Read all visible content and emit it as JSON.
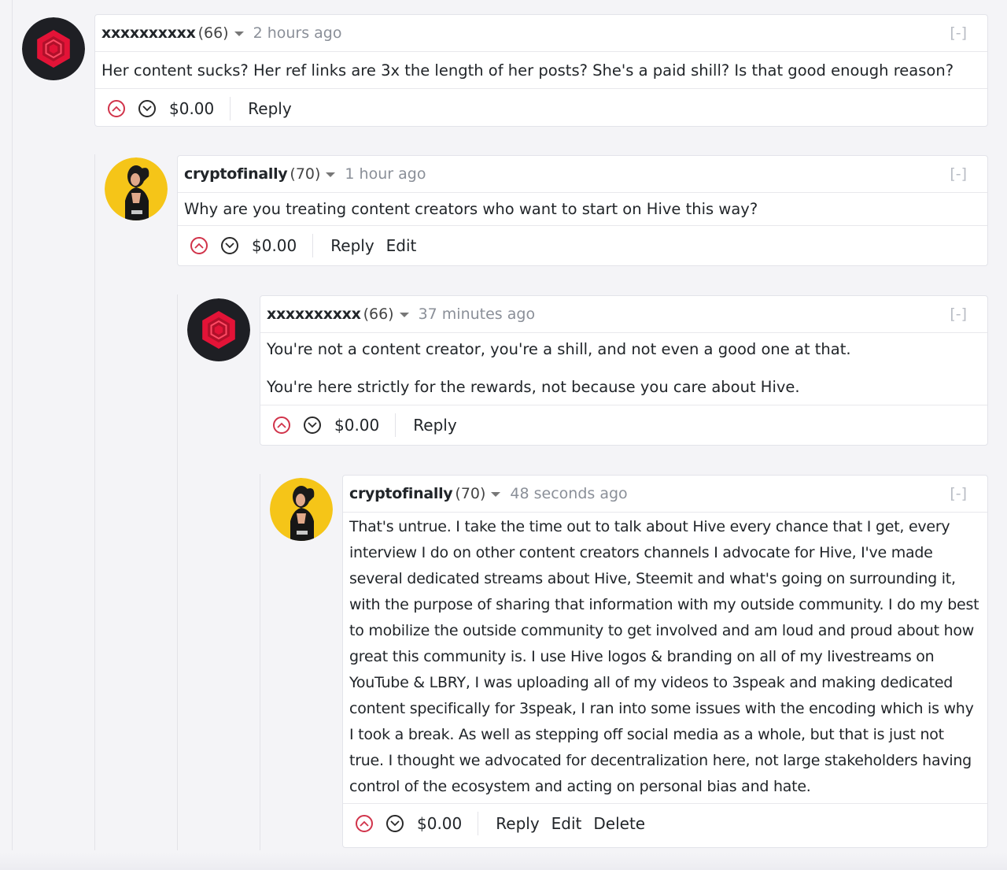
{
  "comments": [
    {
      "author": "xxxxxxxxxx",
      "reputation": "(66)",
      "time": "2 hours ago",
      "collapse": "[-]",
      "paragraphs": [
        "Her content sucks? Her ref links are 3x the length of her posts? She's a paid shill? Is that good enough reason?"
      ],
      "payout": "$0.00",
      "actions": [
        "Reply"
      ],
      "avatar_icon": "hive-hexagon-icon"
    },
    {
      "author": "cryptofinally",
      "reputation": "(70)",
      "time": "1 hour ago",
      "collapse": "[-]",
      "paragraphs": [
        "Why are you treating content creators who want to start on Hive this way?"
      ],
      "payout": "$0.00",
      "actions": [
        "Reply",
        "Edit"
      ],
      "avatar_icon": "user-photo"
    },
    {
      "author": "xxxxxxxxxx",
      "reputation": "(66)",
      "time": "37 minutes ago",
      "collapse": "[-]",
      "paragraphs": [
        "You're not a content creator, you're a shill, and not even a good one at that.",
        "You're here strictly for the rewards, not because you care about Hive."
      ],
      "payout": "$0.00",
      "actions": [
        "Reply"
      ],
      "avatar_icon": "hive-hexagon-icon"
    },
    {
      "author": "cryptofinally",
      "reputation": "(70)",
      "time": "48 seconds ago",
      "collapse": "[-]",
      "paragraphs": [
        "That's untrue. I take the time out to talk about Hive every chance that I get, every interview I do on other content creators channels I advocate for Hive, I've made several dedicated streams about Hive, Steemit and what's going on surrounding it, with the purpose of sharing that information with my outside community. I do my best to mobilize the outside community to get involved and am loud and proud about how great this community is. I use Hive logos & branding on all of my livestreams on YouTube & LBRY, I was uploading all of my videos to 3speak and making dedicated content specifically for 3speak, I ran into some issues with the encoding which is why I took a break. As well as stepping off social media as a whole, but that is just not true. I thought we advocated for decentralization here, not large stakeholders having control of the ecosystem and acting on personal bias and hate."
      ],
      "payout": "$0.00",
      "actions": [
        "Reply",
        "Edit",
        "Delete"
      ],
      "avatar_icon": "user-photo"
    }
  ],
  "colors": {
    "upvote": "#d1334a",
    "hive_red": "#e31337",
    "avatar_dark": "#1e1f24",
    "photo_bg": "#f5c518"
  }
}
